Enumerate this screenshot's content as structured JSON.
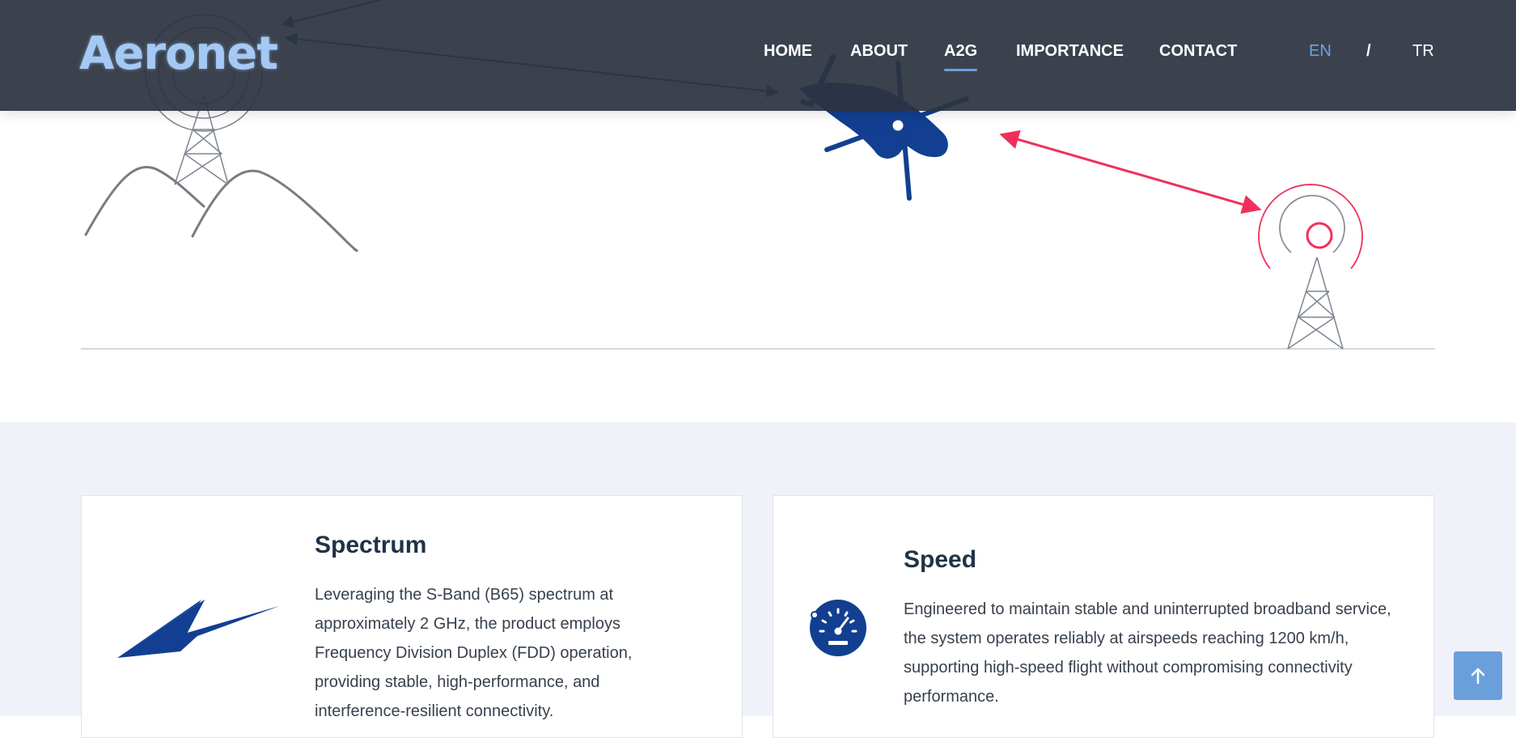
{
  "header": {
    "logo": "Aeronet",
    "nav": [
      {
        "label": "HOME"
      },
      {
        "label": "ABOUT"
      },
      {
        "label": "A2G",
        "active": true
      },
      {
        "label": "IMPORTANCE"
      },
      {
        "label": "CONTACT"
      }
    ],
    "languages": {
      "en": "EN",
      "separator": "/",
      "tr": "TR",
      "selected": "EN"
    }
  },
  "colors": {
    "header_bg": "#2c3441",
    "logo": "#a5c9f5",
    "accent": "#6aa0e0",
    "icon_blue": "#123f91",
    "signal_red": "#f0305a",
    "link_teal": "#1f4f63"
  },
  "features": [
    {
      "title": "Spectrum",
      "icon": "lightning-bolt-icon",
      "text": "Leveraging the S-Band (B65) spectrum at approximately 2 GHz, the product employs Frequency Division Duplex (FDD) operation, providing stable, high-performance, and interference-resilient connectivity."
    },
    {
      "title": "Speed",
      "icon": "speedometer-icon",
      "text": "Engineered to maintain stable and uninterrupted broadband service, the system operates reliably at airspeeds reaching 1200 km/h, supporting high-speed flight without compromising connectivity performance."
    }
  ],
  "scroll_top": {
    "icon": "arrow-up-icon"
  }
}
